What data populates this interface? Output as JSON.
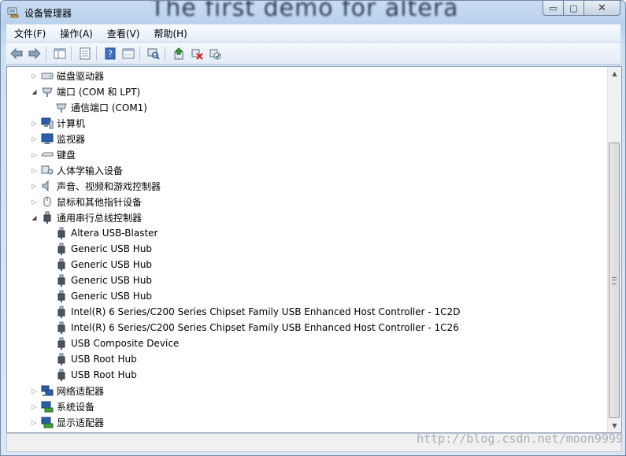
{
  "window": {
    "title": "设备管理器",
    "watermark_title": "The first demo for altera",
    "buttons": {
      "minimize": "▭",
      "maximize": "▢",
      "close": "✕"
    }
  },
  "menu": [
    "文件(F)",
    "操作(A)",
    "查看(V)",
    "帮助(H)"
  ],
  "toolbar": {
    "buttons": [
      "back-arrow-icon",
      "forward-arrow-icon",
      "console-tree-icon",
      "properties-icon",
      "help-icon",
      "view-icon",
      "scan-hardware-icon",
      "update-driver-icon",
      "uninstall-icon",
      "enable-device-icon"
    ]
  },
  "tree": [
    {
      "label": "磁盘驱动器",
      "level": 0,
      "expander": "collapsed",
      "icon": "disk-drive-icon"
    },
    {
      "label": "端口 (COM 和 LPT)",
      "level": 0,
      "expander": "expanded",
      "icon": "port-icon"
    },
    {
      "label": "通信端口 (COM1)",
      "level": 1,
      "expander": "none",
      "icon": "port-icon"
    },
    {
      "label": "计算机",
      "level": 0,
      "expander": "collapsed",
      "icon": "computer-icon"
    },
    {
      "label": "监视器",
      "level": 0,
      "expander": "collapsed",
      "icon": "monitor-icon"
    },
    {
      "label": "键盘",
      "level": 0,
      "expander": "collapsed",
      "icon": "keyboard-icon"
    },
    {
      "label": "人体学输入设备",
      "level": 0,
      "expander": "collapsed",
      "icon": "hid-icon"
    },
    {
      "label": "声音、视频和游戏控制器",
      "level": 0,
      "expander": "collapsed",
      "icon": "speaker-icon"
    },
    {
      "label": "鼠标和其他指针设备",
      "level": 0,
      "expander": "collapsed",
      "icon": "mouse-icon"
    },
    {
      "label": "通用串行总线控制器",
      "level": 0,
      "expander": "expanded",
      "icon": "usb-icon"
    },
    {
      "label": "Altera USB-Blaster",
      "level": 1,
      "expander": "none",
      "icon": "usb-icon"
    },
    {
      "label": "Generic USB Hub",
      "level": 1,
      "expander": "none",
      "icon": "usb-icon"
    },
    {
      "label": "Generic USB Hub",
      "level": 1,
      "expander": "none",
      "icon": "usb-icon"
    },
    {
      "label": "Generic USB Hub",
      "level": 1,
      "expander": "none",
      "icon": "usb-icon"
    },
    {
      "label": "Generic USB Hub",
      "level": 1,
      "expander": "none",
      "icon": "usb-icon"
    },
    {
      "label": "Intel(R) 6 Series/C200 Series Chipset Family USB Enhanced Host Controller - 1C2D",
      "level": 1,
      "expander": "none",
      "icon": "usb-icon"
    },
    {
      "label": "Intel(R) 6 Series/C200 Series Chipset Family USB Enhanced Host Controller - 1C26",
      "level": 1,
      "expander": "none",
      "icon": "usb-icon"
    },
    {
      "label": "USB Composite Device",
      "level": 1,
      "expander": "none",
      "icon": "usb-icon"
    },
    {
      "label": "USB Root Hub",
      "level": 1,
      "expander": "none",
      "icon": "usb-icon"
    },
    {
      "label": "USB Root Hub",
      "level": 1,
      "expander": "none",
      "icon": "usb-icon"
    },
    {
      "label": "网络适配器",
      "level": 0,
      "expander": "collapsed",
      "icon": "network-adapter-icon"
    },
    {
      "label": "系统设备",
      "level": 0,
      "expander": "collapsed",
      "icon": "system-device-icon"
    },
    {
      "label": "显示适配器",
      "level": 0,
      "expander": "collapsed",
      "icon": "display-adapter-icon"
    }
  ],
  "scrollbar": {
    "up": "▲",
    "down": "▼"
  },
  "status_watermark": "http://blog.csdn.net/moon9999"
}
